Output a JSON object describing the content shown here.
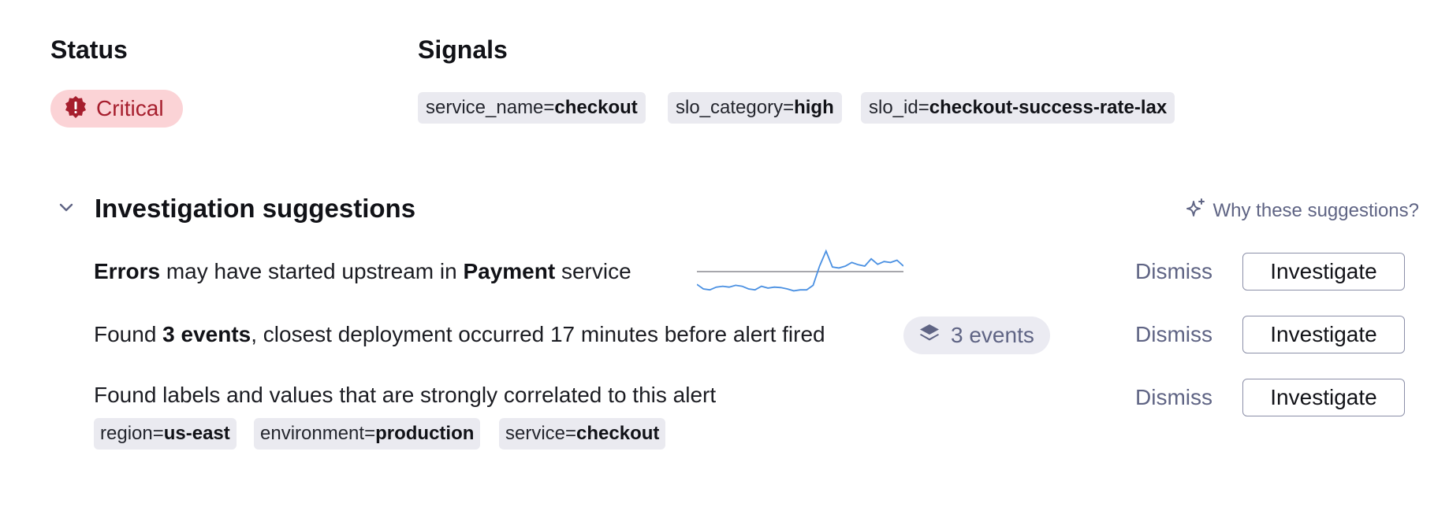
{
  "status": {
    "heading": "Status",
    "badge_label": "Critical",
    "badge_icon": "alert-seal-icon"
  },
  "signals": {
    "heading": "Signals",
    "items": [
      {
        "key": "service_name=",
        "value": "checkout"
      },
      {
        "key": "slo_category=",
        "value": "high"
      },
      {
        "key": "slo_id=",
        "value": "checkout-success-rate-lax"
      }
    ]
  },
  "investigation": {
    "title": "Investigation suggestions",
    "toggle_icon": "chevron-down-icon",
    "why_label": "Why these suggestions?",
    "why_icon": "sparkle-icon",
    "rows": [
      {
        "parts": [
          {
            "text": "Errors",
            "bold": true
          },
          {
            "text": " may have started upstream in ",
            "bold": false
          },
          {
            "text": "Payment",
            "bold": true
          },
          {
            "text": " service",
            "bold": false
          }
        ],
        "dismiss": "Dismiss",
        "investigate": "Investigate"
      },
      {
        "parts": [
          {
            "text": "Found ",
            "bold": false
          },
          {
            "text": "3 events",
            "bold": true
          },
          {
            "text": ", closest deployment occurred 17 minutes before alert fired",
            "bold": false
          }
        ],
        "chip_label": "3 events",
        "chip_icon": "layers-icon",
        "dismiss": "Dismiss",
        "investigate": "Investigate"
      },
      {
        "parts": [
          {
            "text": "Found labels and values that are strongly correlated to this alert",
            "bold": false
          }
        ],
        "labels": [
          {
            "key": "region=",
            "value": "us-east"
          },
          {
            "key": "environment=",
            "value": "production"
          },
          {
            "key": "service=",
            "value": "checkout"
          }
        ],
        "dismiss": "Dismiss",
        "investigate": "Investigate"
      }
    ]
  },
  "sparkline": {
    "threshold": 0.5,
    "values": [
      0.22,
      0.12,
      0.1,
      0.16,
      0.18,
      0.16,
      0.2,
      0.18,
      0.12,
      0.1,
      0.18,
      0.14,
      0.16,
      0.15,
      0.12,
      0.08,
      0.1,
      0.1,
      0.2,
      0.62,
      0.95,
      0.6,
      0.58,
      0.62,
      0.7,
      0.65,
      0.62,
      0.78,
      0.66,
      0.72,
      0.7,
      0.75,
      0.62
    ],
    "line_color": "#4a90e2",
    "threshold_color": "#8a8a90"
  },
  "colors": {
    "critical_bg": "#fbd3d6",
    "critical_fg": "#a61e2d",
    "muted": "#5f6484",
    "pill_bg": "#eaeaf0"
  }
}
